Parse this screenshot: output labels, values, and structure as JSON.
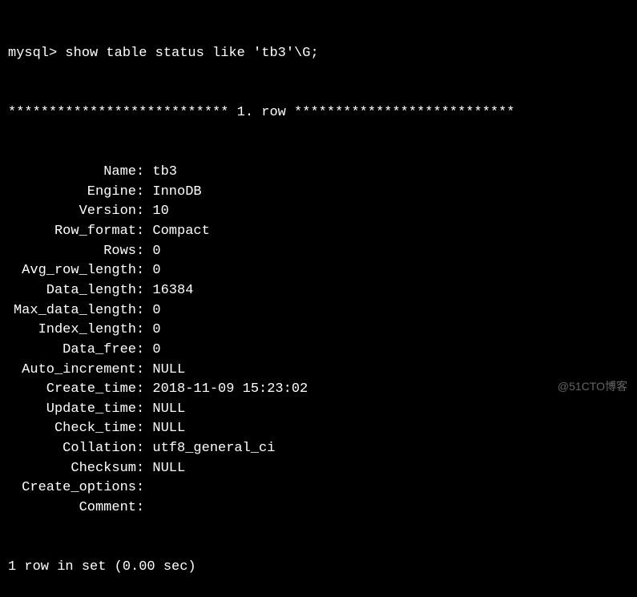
{
  "prompt": "mysql> show table status like 'tb3'\\G;",
  "separator": "*************************** 1. row ***************************",
  "fields": [
    {
      "label": "Name",
      "value": "tb3"
    },
    {
      "label": "Engine",
      "value": "InnoDB"
    },
    {
      "label": "Version",
      "value": "10"
    },
    {
      "label": "Row_format",
      "value": "Compact"
    },
    {
      "label": "Rows",
      "value": "0"
    },
    {
      "label": "Avg_row_length",
      "value": "0"
    },
    {
      "label": "Data_length",
      "value": "16384"
    },
    {
      "label": "Max_data_length",
      "value": "0"
    },
    {
      "label": "Index_length",
      "value": "0"
    },
    {
      "label": "Data_free",
      "value": "0"
    },
    {
      "label": "Auto_increment",
      "value": "NULL"
    },
    {
      "label": "Create_time",
      "value": "2018-11-09 15:23:02"
    },
    {
      "label": "Update_time",
      "value": "NULL"
    },
    {
      "label": "Check_time",
      "value": "NULL"
    },
    {
      "label": "Collation",
      "value": "utf8_general_ci"
    },
    {
      "label": "Checksum",
      "value": "NULL"
    },
    {
      "label": "Create_options",
      "value": ""
    },
    {
      "label": "Comment",
      "value": ""
    }
  ],
  "footer": "1 row in set (0.00 sec)",
  "watermark": "@51CTO博客"
}
